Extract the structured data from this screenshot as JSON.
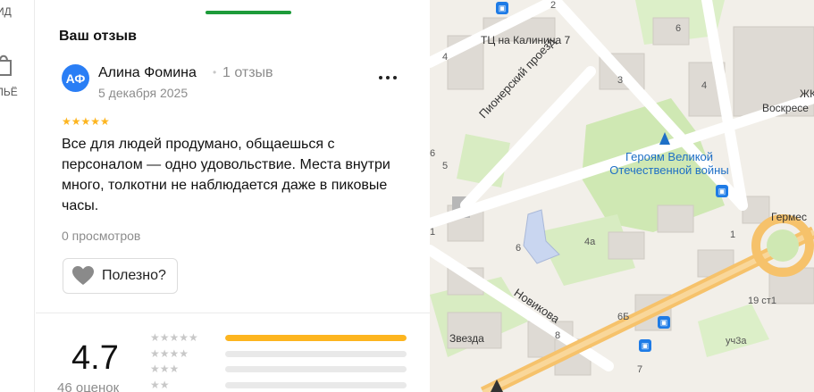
{
  "rail": {
    "top_text": "ИД",
    "bottom_text": "ЛЬЁ"
  },
  "review": {
    "section_title": "Ваш отзыв",
    "avatar_initials": "АФ",
    "author_name": "Алина Фомина",
    "separator": "•",
    "author_reviews": "1 отзыв",
    "date": "5 декабря 2025",
    "stars": "★★★★★",
    "rating": 5,
    "text": "Все для людей продумано, общаешься с персоналом — одно удовольствие. Места внутри много, толкотни не наблюдается даже в пиковые часы.",
    "views": "0 просмотров",
    "useful_label": "Полезно?",
    "more_icon": "more-dots-icon"
  },
  "summary": {
    "score": "4.7",
    "count_label": "46 оценок",
    "rows": [
      {
        "stars": "★★★★★",
        "share": 1.0
      },
      {
        "stars": "★★★★",
        "share": 0.0
      },
      {
        "stars": "★★★",
        "share": 0.0
      },
      {
        "stars": "★★",
        "share": 0.0
      }
    ]
  },
  "map": {
    "labels": {
      "tc": "ТЦ на Калинина 7",
      "pionersky": "Пионерский проезд",
      "heroes": "Героям Великой\nОтечественной войны",
      "novikova": "Новикова",
      "zvezda": "Звезда",
      "germes": "Гермес",
      "zhk": "ЖК",
      "voskres": "Воскресе",
      "n4a": "4а",
      "n6b": "6Б",
      "n19": "19 ст1",
      "nuch": "уч3а",
      "n1": "1",
      "n2": "2",
      "n3": "3",
      "n4": "4",
      "n4b": "4",
      "n5": "5",
      "n6": "6",
      "n6c": "6",
      "n7": "7",
      "n8": "8",
      "n1b": "1",
      "n6x": "6"
    },
    "colors": {
      "bg": "#f2efe9",
      "park": "#cfe8b3",
      "road_main": "#f6c26b",
      "road": "#ffffff",
      "building": "#dedad4"
    }
  }
}
